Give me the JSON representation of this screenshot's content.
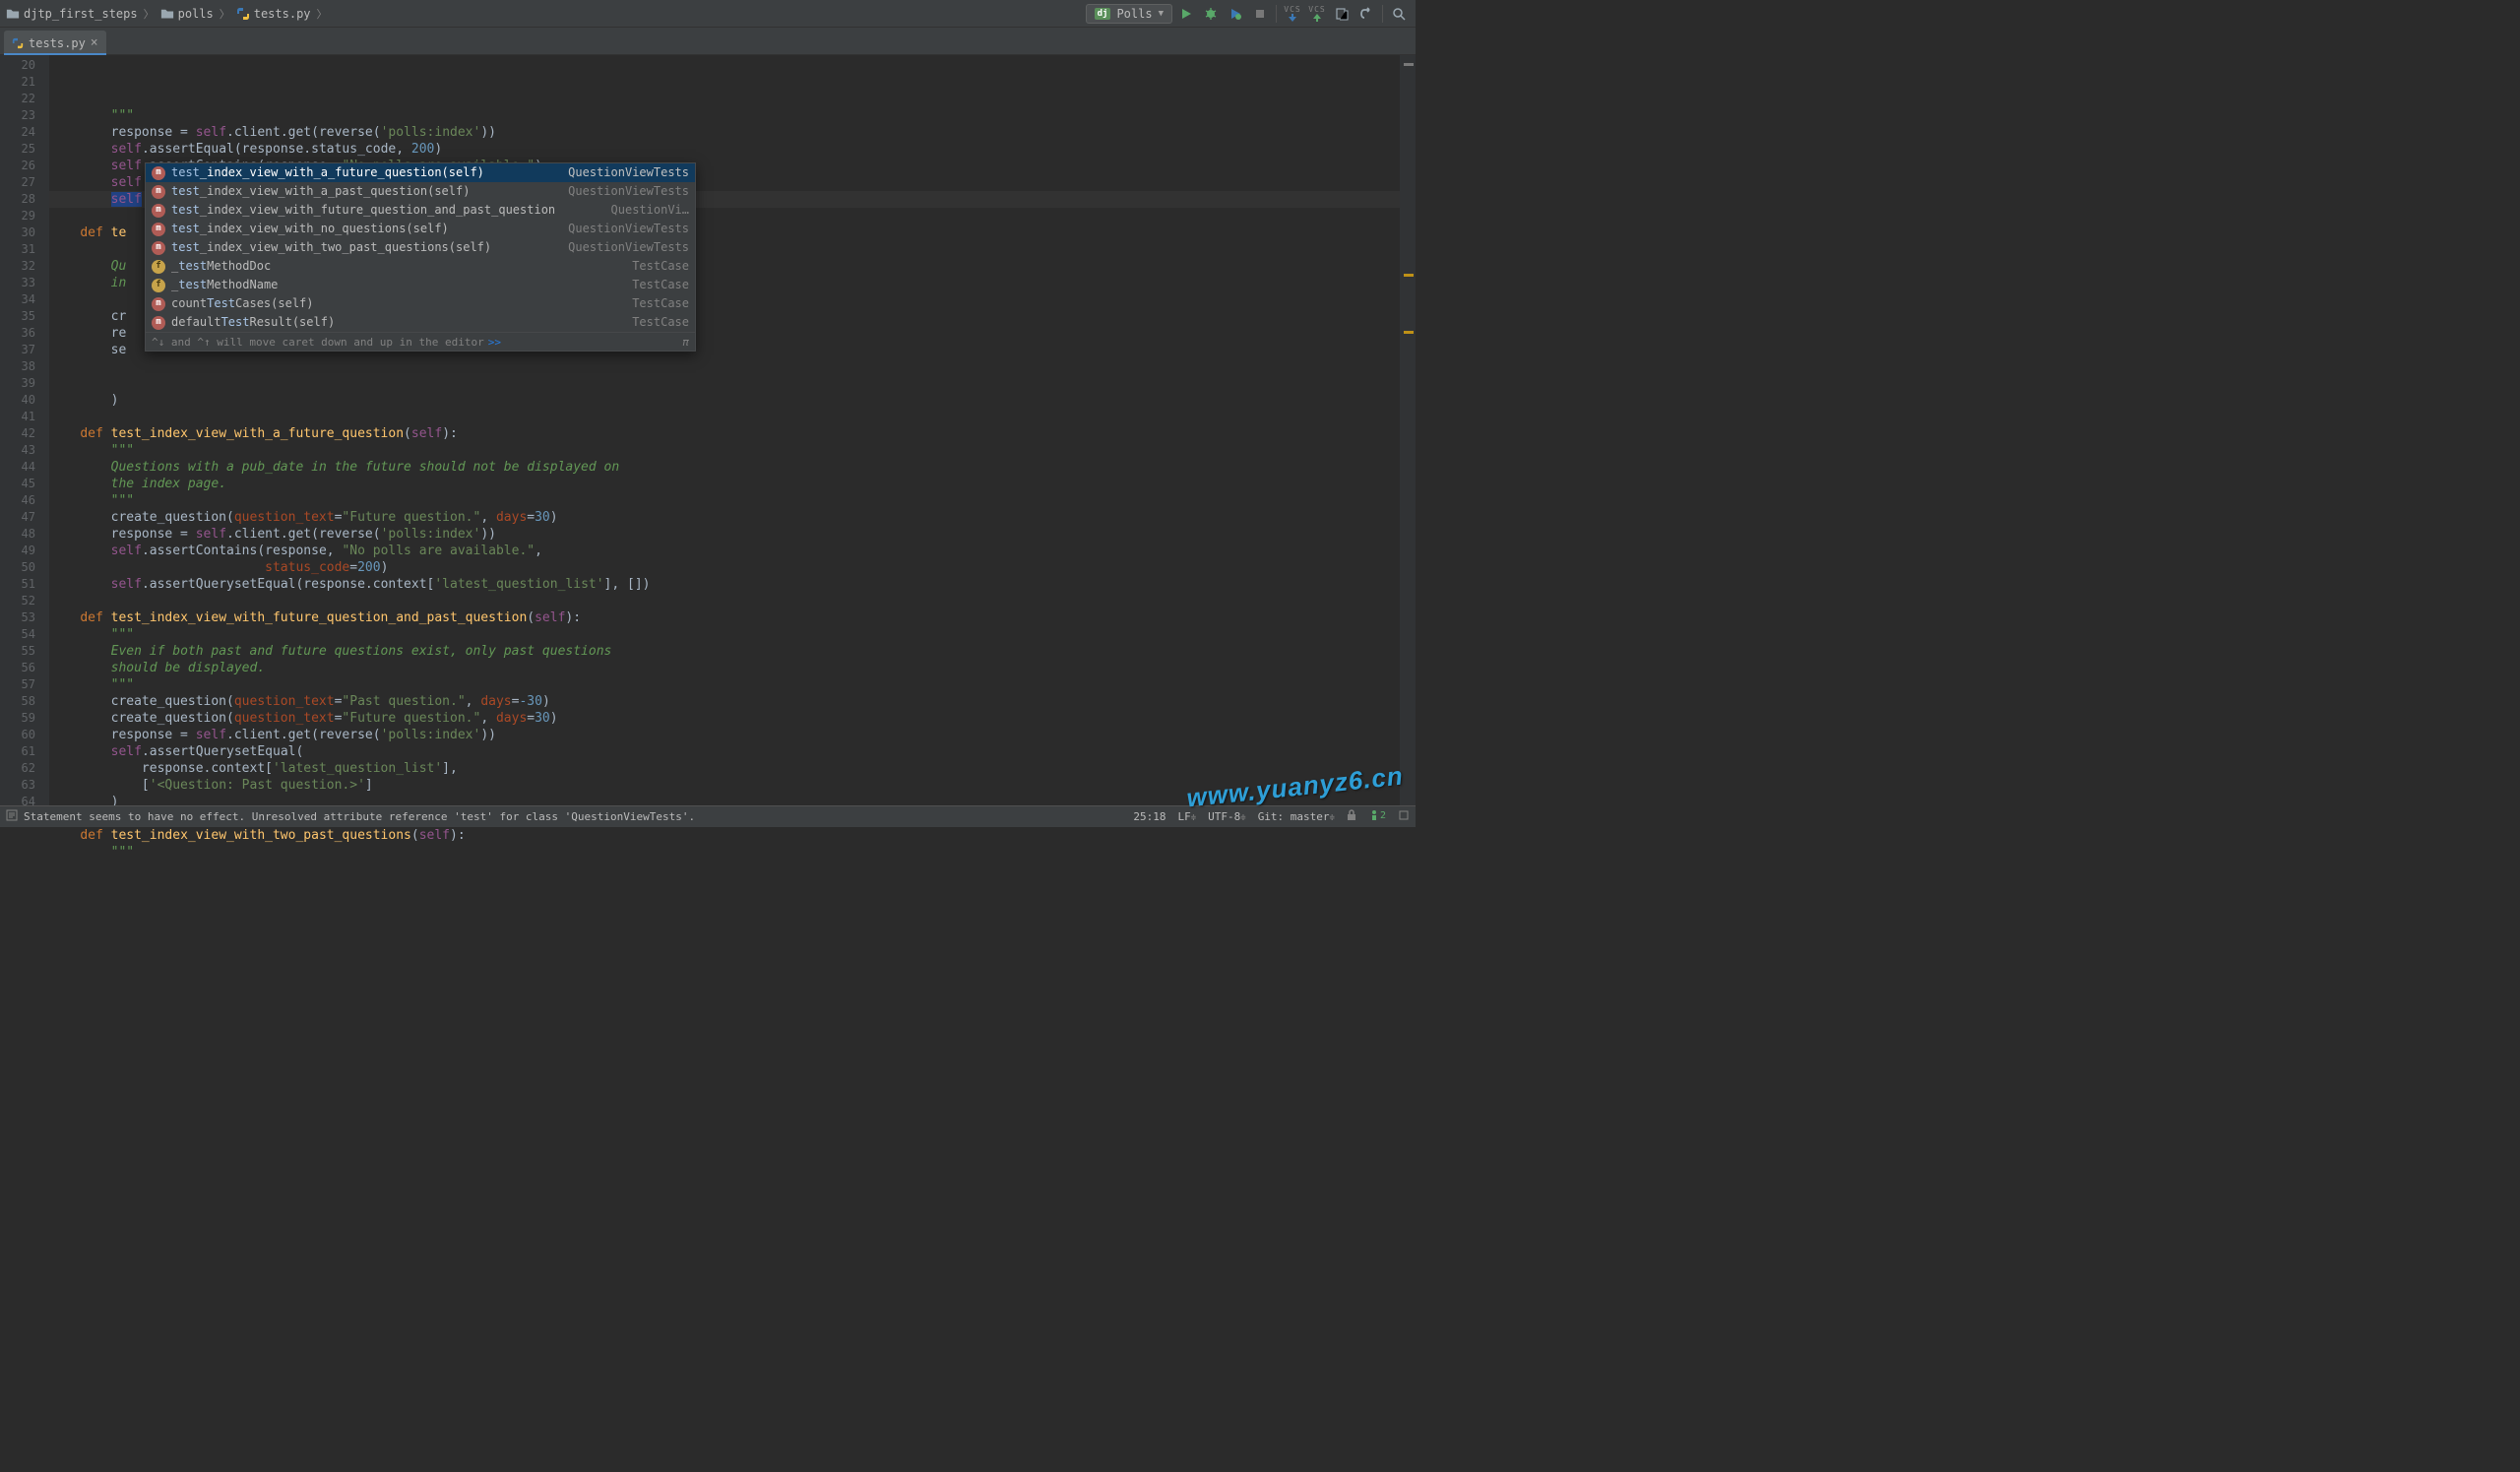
{
  "breadcrumb": {
    "items": [
      {
        "label": "djtp_first_steps",
        "kind": "folder"
      },
      {
        "label": "polls",
        "kind": "folder"
      },
      {
        "label": "tests.py",
        "kind": "pyfile"
      }
    ]
  },
  "run_config": {
    "name": "Polls",
    "framework": "dj"
  },
  "tabs": [
    {
      "name": "tests.py",
      "active": true
    }
  ],
  "gutter": {
    "start": 20,
    "end": 64
  },
  "code_lines": [
    {
      "n": 20,
      "html": "        <span class='docstr'>\"\"\"</span>"
    },
    {
      "n": 21,
      "html": "        response = <span class='self'>self</span>.client.get(reverse(<span class='str'>'polls:index'</span>))"
    },
    {
      "n": 22,
      "html": "        <span class='self'>self</span>.assertEqual(response.status_code, <span class='num'>200</span>)"
    },
    {
      "n": 23,
      "html": "        <span class='self'>self</span>.assertContains(response, <span class='str'>\"No polls are available.\"</span>)"
    },
    {
      "n": 24,
      "html": "        <span class='self'>self</span>.assertQuerysetEqual(response.context[<span class='str'>'latest_question_list'</span>], [])"
    },
    {
      "n": 25,
      "html": "        <span class='sel-bg'><span class='self'>self</span></span>.test<span class='caret'></span>"
    },
    {
      "n": 26,
      "html": ""
    },
    {
      "n": 27,
      "html": "    <span class='kw'>def</span> <span class='fn'>te</span>"
    },
    {
      "n": 28,
      "html": "        "
    },
    {
      "n": 29,
      "html": "        <span class='docstr'>Qu</span>"
    },
    {
      "n": 30,
      "html": "        <span class='docstr'>in</span>"
    },
    {
      "n": 31,
      "html": "        "
    },
    {
      "n": 32,
      "html": "        cr"
    },
    {
      "n": 33,
      "html": "        re"
    },
    {
      "n": 34,
      "html": "        se"
    },
    {
      "n": 35,
      "html": ""
    },
    {
      "n": 36,
      "html": ""
    },
    {
      "n": 37,
      "html": "        )"
    },
    {
      "n": 38,
      "html": ""
    },
    {
      "n": 39,
      "html": "    <span class='kw'>def</span> <span class='fn'>test_index_view_with_a_future_question</span>(<span class='self'>self</span>):"
    },
    {
      "n": 40,
      "html": "        <span class='docstr'>\"\"\"</span>"
    },
    {
      "n": 41,
      "html": "        <span class='docstr'>Questions with a pub_date in the future should not be displayed on</span>"
    },
    {
      "n": 42,
      "html": "        <span class='docstr'>the index page.</span>"
    },
    {
      "n": 43,
      "html": "        <span class='docstr'>\"\"\"</span>"
    },
    {
      "n": 44,
      "html": "        create_question(<span class='param'>question_text</span>=<span class='str'>\"Future question.\"</span>, <span class='param'>days</span>=<span class='num'>30</span>)"
    },
    {
      "n": 45,
      "html": "        response = <span class='self'>self</span>.client.get(reverse(<span class='str'>'polls:index'</span>))"
    },
    {
      "n": 46,
      "html": "        <span class='self'>self</span>.assertContains(response, <span class='str'>\"No polls are available.\"</span>,"
    },
    {
      "n": 47,
      "html": "                            <span class='param'>status_code</span>=<span class='num'>200</span>)"
    },
    {
      "n": 48,
      "html": "        <span class='self'>self</span>.assertQuerysetEqual(response.context[<span class='str'>'latest_question_list'</span>], [])"
    },
    {
      "n": 49,
      "html": ""
    },
    {
      "n": 50,
      "html": "    <span class='kw'>def</span> <span class='fn'>test_index_view_with_future_question_and_past_question</span>(<span class='self'>self</span>):"
    },
    {
      "n": 51,
      "html": "        <span class='docstr'>\"\"\"</span>"
    },
    {
      "n": 52,
      "html": "        <span class='docstr'>Even if both past and future questions exist, only past questions</span>"
    },
    {
      "n": 53,
      "html": "        <span class='docstr'>should be displayed.</span>"
    },
    {
      "n": 54,
      "html": "        <span class='docstr'>\"\"\"</span>"
    },
    {
      "n": 55,
      "html": "        create_question(<span class='param'>question_text</span>=<span class='str'>\"Past question.\"</span>, <span class='param'>days</span>=<span class='num'>-30</span>)"
    },
    {
      "n": 56,
      "html": "        create_question(<span class='param'>question_text</span>=<span class='str'>\"Future question.\"</span>, <span class='param'>days</span>=<span class='num'>30</span>)"
    },
    {
      "n": 57,
      "html": "        response = <span class='self'>self</span>.client.get(reverse(<span class='str'>'polls:index'</span>))"
    },
    {
      "n": 58,
      "html": "        <span class='self'>self</span>.assertQuerysetEqual("
    },
    {
      "n": 59,
      "html": "            response.context[<span class='str'>'latest_question_list'</span>],"
    },
    {
      "n": 60,
      "html": "            [<span class='str'>'&lt;Question: Past question.&gt;'</span>]"
    },
    {
      "n": 61,
      "html": "        )"
    },
    {
      "n": 62,
      "html": ""
    },
    {
      "n": 63,
      "html": "    <span class='kw'>def</span> <span class='fn'>test_index_view_with_two_past_questions</span>(<span class='self'>self</span>):"
    },
    {
      "n": 64,
      "html": "        <span class='docstr'>\"\"\"</span>"
    }
  ],
  "completion": {
    "items": [
      {
        "icon": "m",
        "name": "test_index_view_with_a_future_question(self)",
        "match": "test",
        "type": "QuestionViewTests",
        "selected": true
      },
      {
        "icon": "m",
        "name": "test_index_view_with_a_past_question(self)",
        "match": "test",
        "type": "QuestionViewTests"
      },
      {
        "icon": "m",
        "name": "test_index_view_with_future_question_and_past_question",
        "match": "test",
        "type": "QuestionVi…"
      },
      {
        "icon": "m",
        "name": "test_index_view_with_no_questions(self)",
        "match": "test",
        "type": "QuestionViewTests"
      },
      {
        "icon": "m",
        "name": "test_index_view_with_two_past_questions(self)",
        "match": "test",
        "type": "QuestionViewTests"
      },
      {
        "icon": "f",
        "name": "_testMethodDoc",
        "match": "test",
        "type": "TestCase"
      },
      {
        "icon": "f",
        "name": "_testMethodName",
        "match": "test",
        "type": "TestCase"
      },
      {
        "icon": "m",
        "name": "countTestCases(self)",
        "match": "Test",
        "type": "TestCase"
      },
      {
        "icon": "m",
        "name": "defaultTestResult(self)",
        "match": "Test",
        "type": "TestCase"
      }
    ],
    "footer_hint": "^↓ and ^↑ will move caret down and up in the editor",
    "footer_link": ">>",
    "pi": "π"
  },
  "status": {
    "message": "Statement seems to have no effect. Unresolved attribute reference 'test' for class 'QuestionViewTests'.",
    "position": "25:18",
    "line_sep": "LF",
    "encoding": "UTF-8",
    "git": "Git: master",
    "vcs_icons": true
  },
  "watermark": "www.yuanyz6.cn"
}
